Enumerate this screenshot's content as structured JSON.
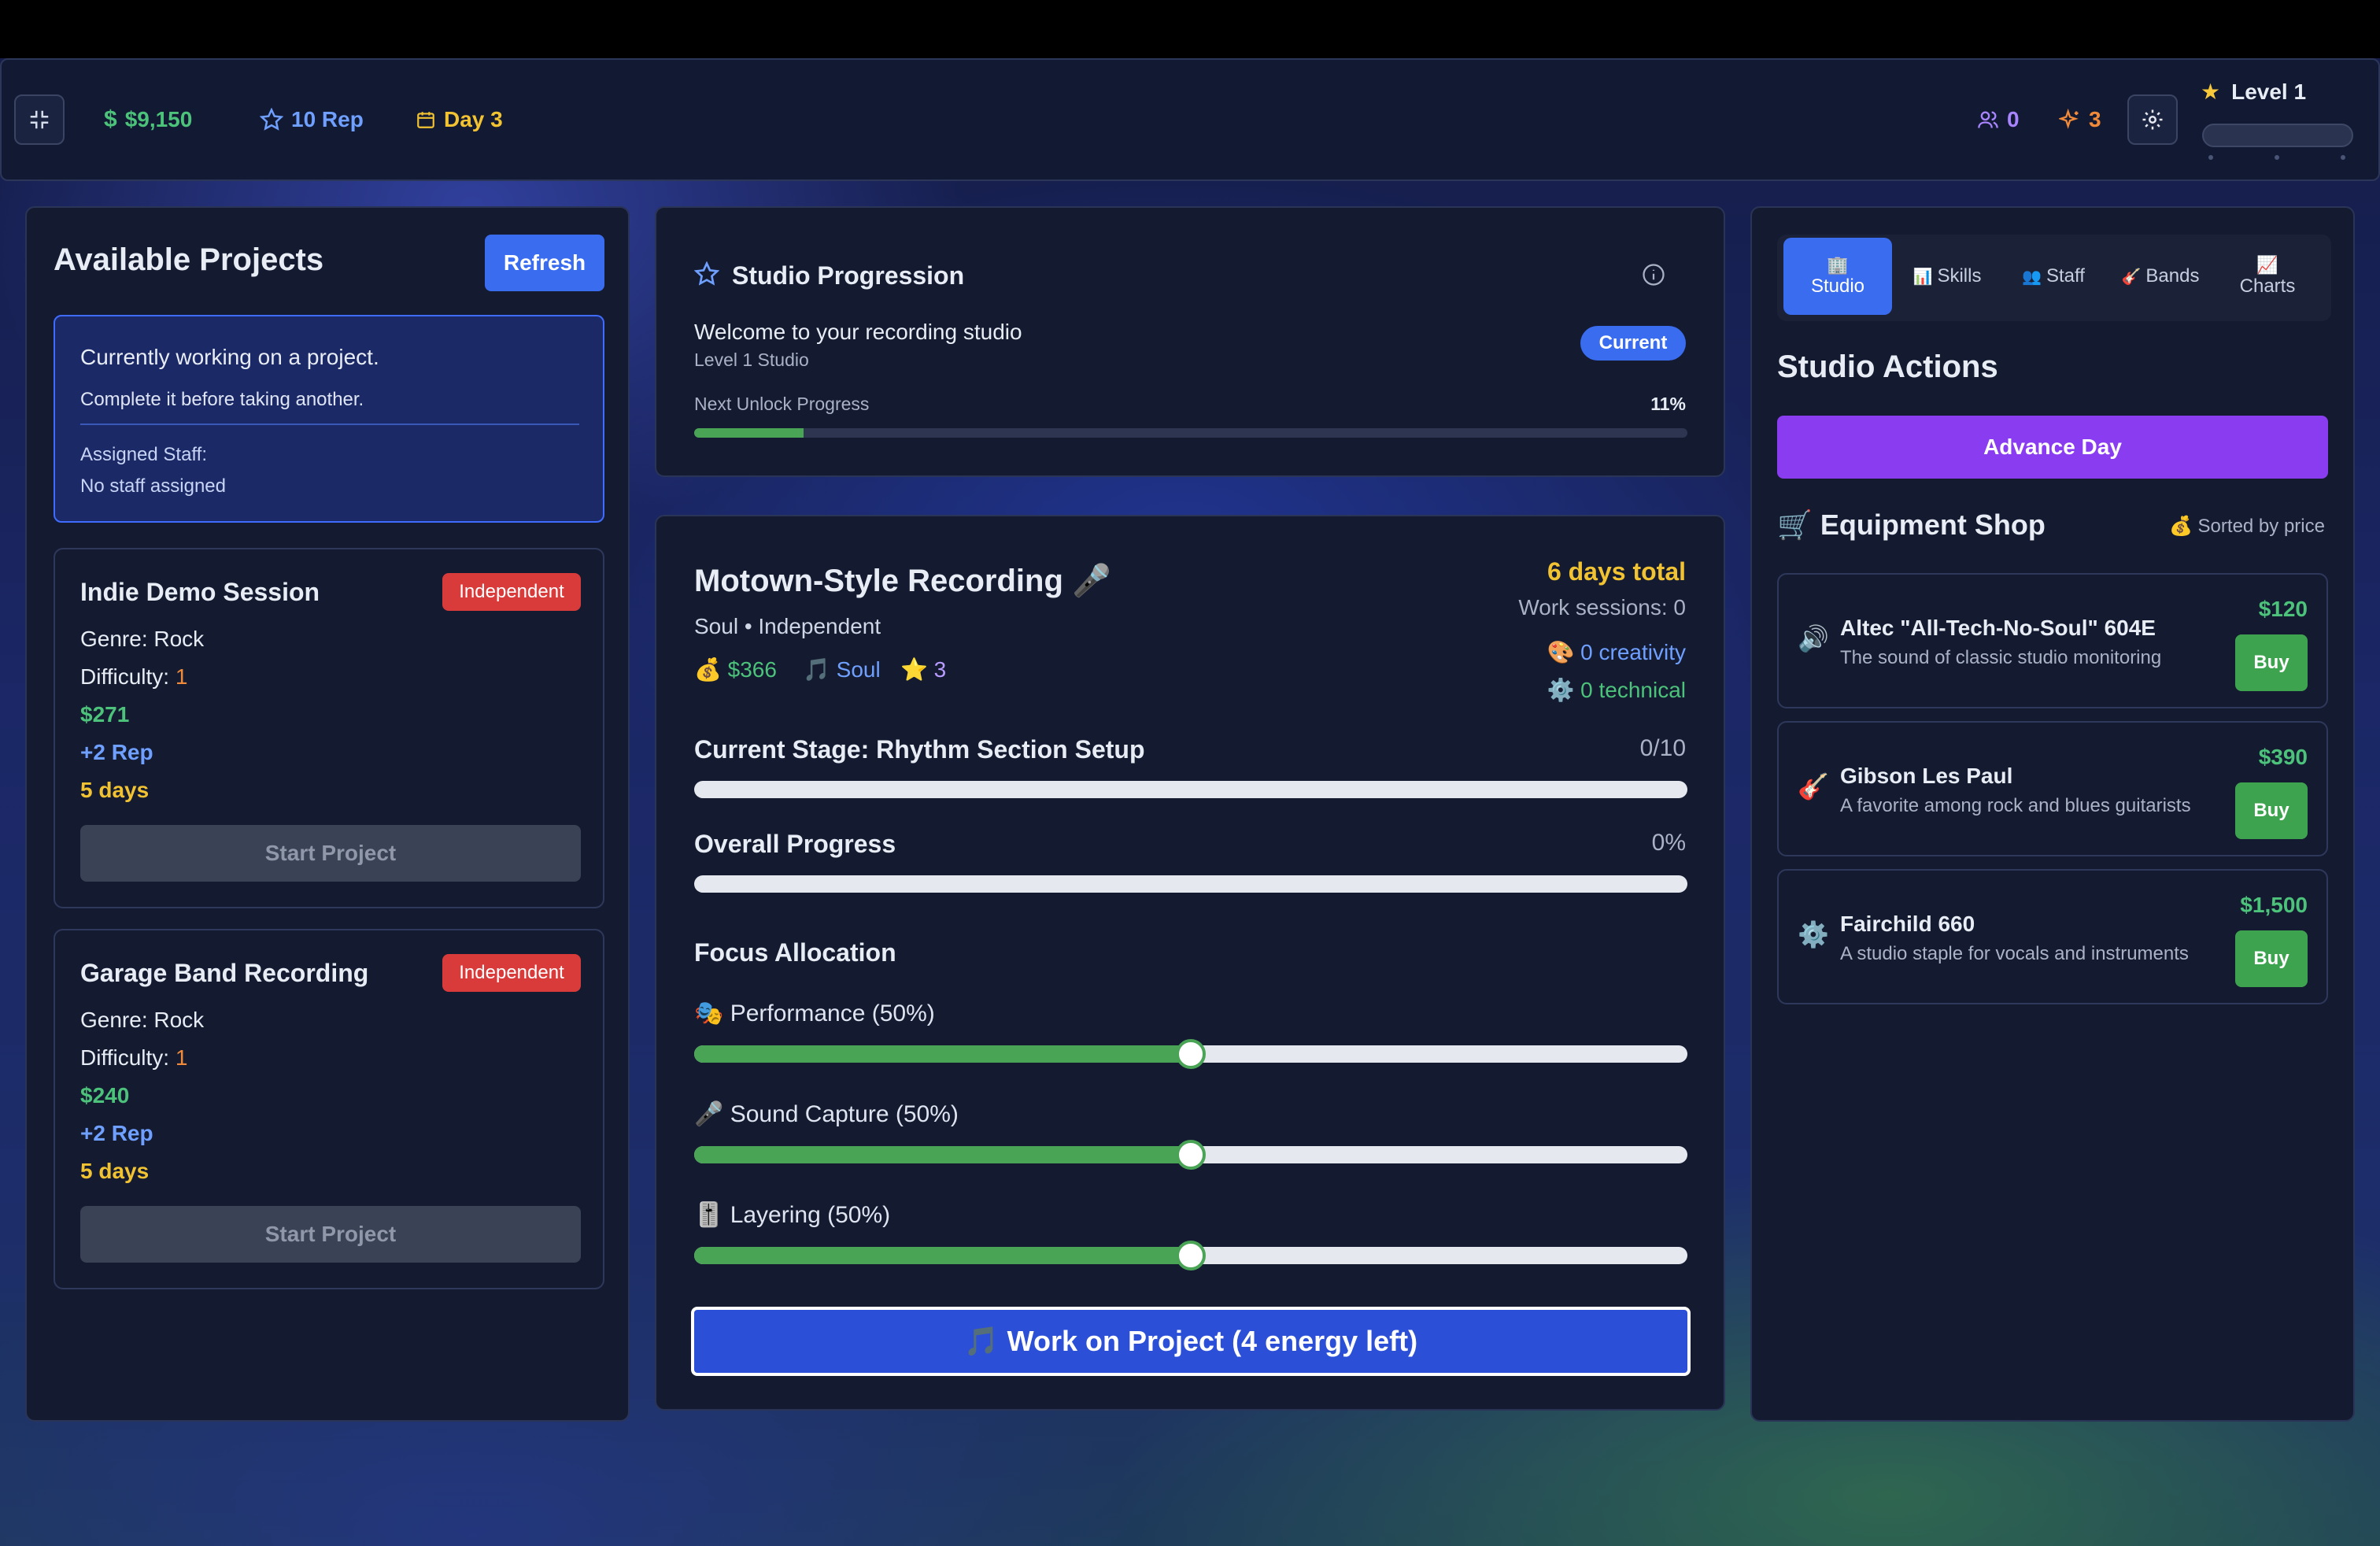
{
  "header": {
    "money": "$9,150",
    "rep": "10 Rep",
    "day": "Day 3",
    "staff_count": "0",
    "ideas_count": "3",
    "level": "Level 1",
    "colors": {
      "money": "#4cc27a",
      "rep": "#6fa0ff",
      "day": "#f1c232",
      "staff": "#a884ff",
      "ideas": "#f08a3a"
    }
  },
  "left": {
    "title": "Available Projects",
    "refresh_label": "Refresh",
    "notice": {
      "line1": "Currently working on a project.",
      "line2": "Complete it before taking another.",
      "staff_label": "Assigned Staff:",
      "staff_value": "No staff assigned"
    },
    "projects": [
      {
        "title": "Indie Demo Session",
        "badge": "Independent",
        "genre": "Genre: Rock",
        "difficulty_label": "Difficulty: ",
        "difficulty": "1",
        "pay": "$271",
        "rep": "+2 Rep",
        "days": "5 days",
        "button": "Start Project"
      },
      {
        "title": "Garage Band Recording",
        "badge": "Independent",
        "genre": "Genre: Rock",
        "difficulty_label": "Difficulty: ",
        "difficulty": "1",
        "pay": "$240",
        "rep": "+2 Rep",
        "days": "5 days",
        "button": "Start Project"
      }
    ]
  },
  "progression": {
    "title": "Studio Progression",
    "welcome": "Welcome to your recording studio",
    "subtitle": "Level 1 Studio",
    "badge": "Current",
    "unlock_label": "Next Unlock Progress",
    "unlock_value": "11%",
    "unlock_fraction": 0.11
  },
  "project": {
    "title": "Motown-Style Recording 🎤",
    "meta": "Soul • Independent",
    "pay": "💰 $366",
    "genre": "🎵 Soul",
    "stars": "⭐ 3",
    "days_total": "6 days total",
    "sessions": "Work sessions: 0",
    "creativity": "🎨 0 creativity",
    "technical": "⚙️ 0 technical",
    "stage_label": "Current Stage: Rhythm Section Setup",
    "stage_value": "0/10",
    "overall_label": "Overall Progress",
    "overall_value": "0%",
    "focus_title": "Focus Allocation",
    "sliders": [
      {
        "label": "🎭 Performance (50%)",
        "value": 0.5
      },
      {
        "label": "🎤 Sound Capture (50%)",
        "value": 0.5
      },
      {
        "label": "🎚️ Layering (50%)",
        "value": 0.5
      }
    ],
    "work_button": "🎵 Work on Project (4 energy left)"
  },
  "right": {
    "tabs": [
      {
        "icon": "🏢",
        "label": "Studio"
      },
      {
        "icon": "📊",
        "label": "Skills"
      },
      {
        "icon": "👥",
        "label": "Staff"
      },
      {
        "icon": "🎸",
        "label": "Bands"
      },
      {
        "icon": "📈",
        "label": "Charts"
      }
    ],
    "actions_title": "Studio Actions",
    "advance_label": "Advance Day",
    "shop_title": "🛒 Equipment Shop",
    "sort_note": "💰 Sorted by price",
    "items": [
      {
        "icon": "🔊",
        "name": "Altec \"All-Tech-No-Soul\" 604E",
        "desc": "The sound of classic studio monitoring",
        "price": "$120",
        "buy": "Buy"
      },
      {
        "icon": "🎸",
        "name": "Gibson Les Paul",
        "desc": "A favorite among rock and blues guitarists",
        "price": "$390",
        "buy": "Buy"
      },
      {
        "icon": "⚙️",
        "name": "Fairchild 660",
        "desc": "A studio staple for vocals and instruments",
        "price": "$1,500",
        "buy": "Buy"
      }
    ]
  }
}
